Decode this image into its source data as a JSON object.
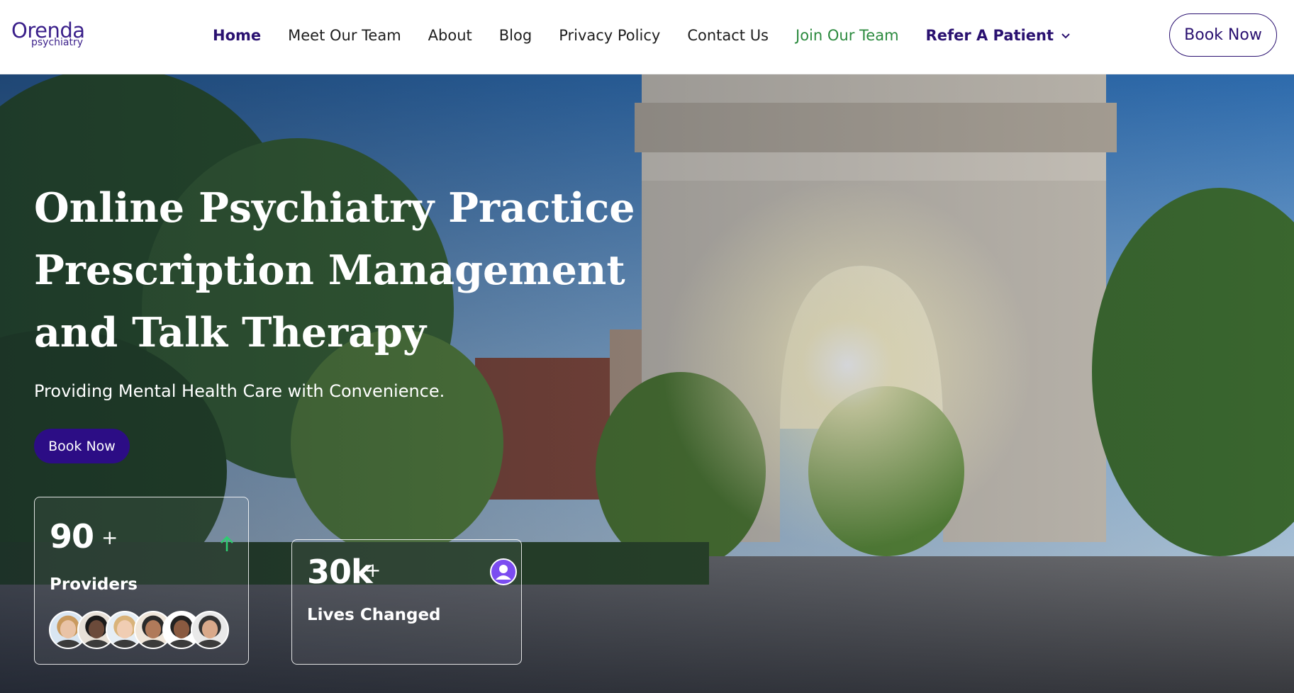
{
  "logo": {
    "main": "Orenda",
    "sub": "psychiatry"
  },
  "nav": {
    "items": [
      {
        "label": "Home",
        "style": "active"
      },
      {
        "label": "Meet Our Team",
        "style": "normal"
      },
      {
        "label": "About",
        "style": "normal"
      },
      {
        "label": "Blog",
        "style": "normal"
      },
      {
        "label": "Privacy Policy",
        "style": "normal"
      },
      {
        "label": "Contact Us",
        "style": "normal"
      },
      {
        "label": "Join Our Team",
        "style": "green"
      },
      {
        "label": "Refer A Patient",
        "style": "bold-dropdown"
      }
    ],
    "book_label": "Book Now"
  },
  "hero": {
    "title_lines": [
      "Online Psychiatry Practice",
      "Prescription Management",
      "and Talk Therapy"
    ],
    "subtitle": "Providing Mental Health Care with Convenience.",
    "book_label": "Book Now"
  },
  "stats": {
    "providers": {
      "number": "90",
      "plus": "+",
      "label": "Providers",
      "icon": "arrow-up-icon"
    },
    "lives": {
      "number": "30k",
      "plus": "+",
      "label": "Lives Changed",
      "icon": "person-icon"
    }
  },
  "avatars": [
    {
      "name": "provider-1",
      "skin": "#e9c3a6",
      "hair": "#c99a5e",
      "bg": "#d9e6f2"
    },
    {
      "name": "provider-2",
      "skin": "#6b4a3a",
      "hair": "#1a1a1a",
      "bg": "#e8e1d8"
    },
    {
      "name": "provider-3",
      "skin": "#f0cdb3",
      "hair": "#d9b37a",
      "bg": "#e6eef5"
    },
    {
      "name": "provider-4",
      "skin": "#b07a5a",
      "hair": "#2a2a2a",
      "bg": "#f0e6da"
    },
    {
      "name": "provider-5",
      "skin": "#8a5a40",
      "hair": "#222222",
      "bg": "#ffffff"
    },
    {
      "name": "provider-6",
      "skin": "#d9a98a",
      "hair": "#333333",
      "bg": "#e9e9e9"
    }
  ],
  "colors": {
    "brand": "#2a1170",
    "button_bg": "#2c0d85",
    "nav_green": "#2b8a3e",
    "arrow_green": "#2ecc71",
    "person_icon_bg": "#7b4cf0"
  }
}
